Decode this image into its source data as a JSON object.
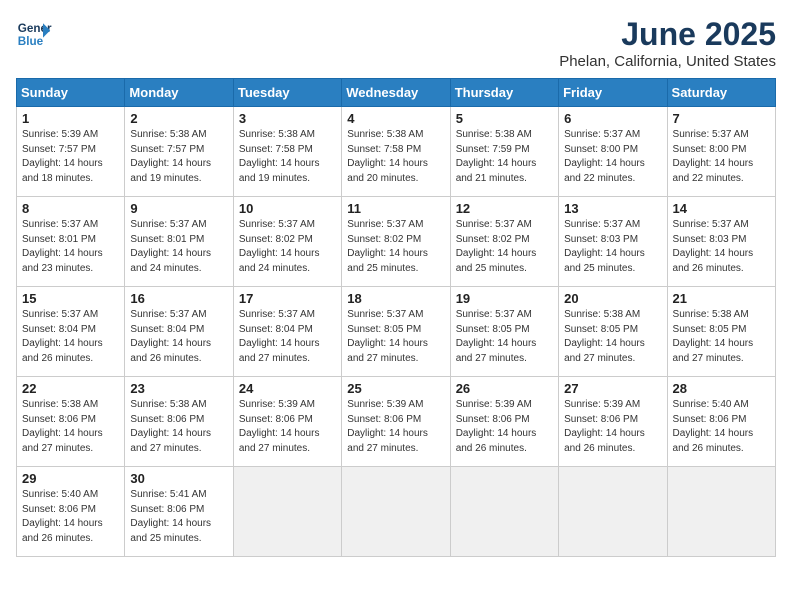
{
  "logo": {
    "line1": "General",
    "line2": "Blue"
  },
  "title": "June 2025",
  "subtitle": "Phelan, California, United States",
  "days_header": [
    "Sunday",
    "Monday",
    "Tuesday",
    "Wednesday",
    "Thursday",
    "Friday",
    "Saturday"
  ],
  "weeks": [
    [
      {
        "num": "1",
        "sunrise": "5:39 AM",
        "sunset": "7:57 PM",
        "daylight": "14 hours and 18 minutes."
      },
      {
        "num": "2",
        "sunrise": "5:38 AM",
        "sunset": "7:57 PM",
        "daylight": "14 hours and 19 minutes."
      },
      {
        "num": "3",
        "sunrise": "5:38 AM",
        "sunset": "7:58 PM",
        "daylight": "14 hours and 19 minutes."
      },
      {
        "num": "4",
        "sunrise": "5:38 AM",
        "sunset": "7:58 PM",
        "daylight": "14 hours and 20 minutes."
      },
      {
        "num": "5",
        "sunrise": "5:38 AM",
        "sunset": "7:59 PM",
        "daylight": "14 hours and 21 minutes."
      },
      {
        "num": "6",
        "sunrise": "5:37 AM",
        "sunset": "8:00 PM",
        "daylight": "14 hours and 22 minutes."
      },
      {
        "num": "7",
        "sunrise": "5:37 AM",
        "sunset": "8:00 PM",
        "daylight": "14 hours and 22 minutes."
      }
    ],
    [
      {
        "num": "8",
        "sunrise": "5:37 AM",
        "sunset": "8:01 PM",
        "daylight": "14 hours and 23 minutes."
      },
      {
        "num": "9",
        "sunrise": "5:37 AM",
        "sunset": "8:01 PM",
        "daylight": "14 hours and 24 minutes."
      },
      {
        "num": "10",
        "sunrise": "5:37 AM",
        "sunset": "8:02 PM",
        "daylight": "14 hours and 24 minutes."
      },
      {
        "num": "11",
        "sunrise": "5:37 AM",
        "sunset": "8:02 PM",
        "daylight": "14 hours and 25 minutes."
      },
      {
        "num": "12",
        "sunrise": "5:37 AM",
        "sunset": "8:02 PM",
        "daylight": "14 hours and 25 minutes."
      },
      {
        "num": "13",
        "sunrise": "5:37 AM",
        "sunset": "8:03 PM",
        "daylight": "14 hours and 25 minutes."
      },
      {
        "num": "14",
        "sunrise": "5:37 AM",
        "sunset": "8:03 PM",
        "daylight": "14 hours and 26 minutes."
      }
    ],
    [
      {
        "num": "15",
        "sunrise": "5:37 AM",
        "sunset": "8:04 PM",
        "daylight": "14 hours and 26 minutes."
      },
      {
        "num": "16",
        "sunrise": "5:37 AM",
        "sunset": "8:04 PM",
        "daylight": "14 hours and 26 minutes."
      },
      {
        "num": "17",
        "sunrise": "5:37 AM",
        "sunset": "8:04 PM",
        "daylight": "14 hours and 27 minutes."
      },
      {
        "num": "18",
        "sunrise": "5:37 AM",
        "sunset": "8:05 PM",
        "daylight": "14 hours and 27 minutes."
      },
      {
        "num": "19",
        "sunrise": "5:37 AM",
        "sunset": "8:05 PM",
        "daylight": "14 hours and 27 minutes."
      },
      {
        "num": "20",
        "sunrise": "5:38 AM",
        "sunset": "8:05 PM",
        "daylight": "14 hours and 27 minutes."
      },
      {
        "num": "21",
        "sunrise": "5:38 AM",
        "sunset": "8:05 PM",
        "daylight": "14 hours and 27 minutes."
      }
    ],
    [
      {
        "num": "22",
        "sunrise": "5:38 AM",
        "sunset": "8:06 PM",
        "daylight": "14 hours and 27 minutes."
      },
      {
        "num": "23",
        "sunrise": "5:38 AM",
        "sunset": "8:06 PM",
        "daylight": "14 hours and 27 minutes."
      },
      {
        "num": "24",
        "sunrise": "5:39 AM",
        "sunset": "8:06 PM",
        "daylight": "14 hours and 27 minutes."
      },
      {
        "num": "25",
        "sunrise": "5:39 AM",
        "sunset": "8:06 PM",
        "daylight": "14 hours and 27 minutes."
      },
      {
        "num": "26",
        "sunrise": "5:39 AM",
        "sunset": "8:06 PM",
        "daylight": "14 hours and 26 minutes."
      },
      {
        "num": "27",
        "sunrise": "5:39 AM",
        "sunset": "8:06 PM",
        "daylight": "14 hours and 26 minutes."
      },
      {
        "num": "28",
        "sunrise": "5:40 AM",
        "sunset": "8:06 PM",
        "daylight": "14 hours and 26 minutes."
      }
    ],
    [
      {
        "num": "29",
        "sunrise": "5:40 AM",
        "sunset": "8:06 PM",
        "daylight": "14 hours and 26 minutes."
      },
      {
        "num": "30",
        "sunrise": "5:41 AM",
        "sunset": "8:06 PM",
        "daylight": "14 hours and 25 minutes."
      },
      null,
      null,
      null,
      null,
      null
    ]
  ]
}
